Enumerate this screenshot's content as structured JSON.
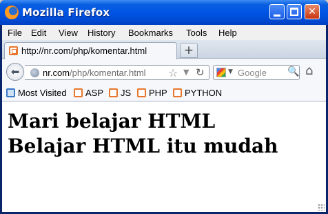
{
  "window": {
    "title": "Mozilla Firefox"
  },
  "menu": [
    {
      "label": "File"
    },
    {
      "label": "Edit"
    },
    {
      "label": "View"
    },
    {
      "label": "History"
    },
    {
      "label": "Bookmarks"
    },
    {
      "label": "Tools"
    },
    {
      "label": "Help"
    }
  ],
  "tab": {
    "label": "http://nr.com/php/komentar.html",
    "new_tab_label": "+"
  },
  "navbar": {
    "url_host": "nr.com",
    "url_path": "/php/komentar.html",
    "search_placeholder": "Google"
  },
  "bookmarks": [
    {
      "label": "Most Visited"
    },
    {
      "label": "ASP"
    },
    {
      "label": "JS"
    },
    {
      "label": "PHP"
    },
    {
      "label": "PYTHON"
    }
  ],
  "content": {
    "line1": "Mari belajar HTML",
    "line2": "Belajar HTML itu mudah"
  },
  "colors": {
    "titlebar": "#0055e5",
    "accent": "#e8762c"
  }
}
